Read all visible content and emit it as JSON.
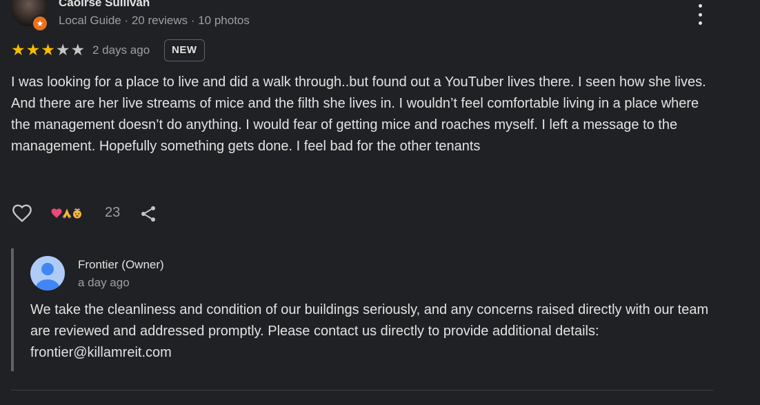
{
  "review": {
    "reviewer_name": "Caoirse Sullivan",
    "reviewer_meta": "Local Guide · 20 reviews · 10 photos",
    "badge_icon": "local-guide-star-icon",
    "rating": 3,
    "rating_max": 5,
    "date": "2 days ago",
    "new_label": "NEW",
    "text": "I was looking for a place to live and did a walk through..but found out a YouTuber lives there. I seen how she lives. And there are her live streams of mice and the filth she lives in. I wouldn’t feel comfortable living in a place where the management doesn’t do anything. I would fear of getting mice and roaches myself. I left a message to the management. Hopefully something gets done. I feel bad for the other tenants",
    "reactions": [
      "heart-emoji",
      "praying-hands-emoji",
      "exploding-head-emoji"
    ],
    "reaction_count": "23"
  },
  "owner_reply": {
    "name": "Frontier (Owner)",
    "date": "a day ago",
    "text": "We take the cleanliness and condition of our buildings seriously, and any concerns raised directly with our team are reviewed and addressed promptly. Please contact us directly to provide additional details: frontier@killamreit.com"
  },
  "colors": {
    "background": "#202124",
    "star": "#fbbc04",
    "muted_text": "#9aa0a6",
    "local_guide_badge": "#e8711e",
    "owner_avatar": "#aecbfa"
  }
}
